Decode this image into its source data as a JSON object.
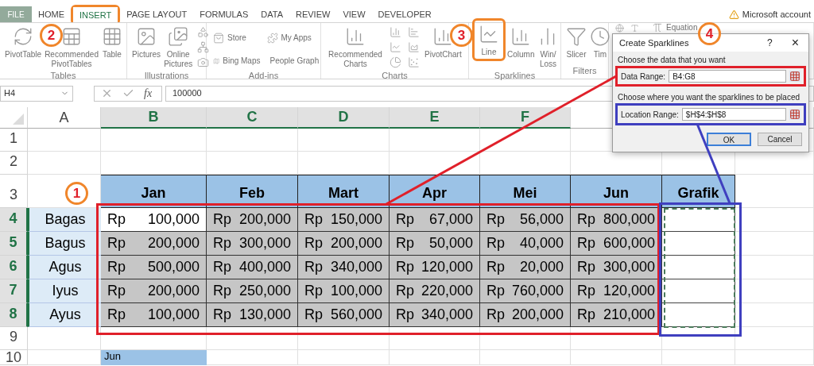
{
  "tabs": [
    {
      "label": "FILE",
      "kind": "file",
      "selected": false
    },
    {
      "label": "HOME",
      "kind": "tab",
      "selected": false
    },
    {
      "label": "INSERT",
      "kind": "tab",
      "selected": true
    },
    {
      "label": "PAGE LAYOUT",
      "kind": "tab",
      "selected": false
    },
    {
      "label": "FORMULAS",
      "kind": "tab",
      "selected": false
    },
    {
      "label": "DATA",
      "kind": "tab",
      "selected": false
    },
    {
      "label": "REVIEW",
      "kind": "tab",
      "selected": false
    },
    {
      "label": "VIEW",
      "kind": "tab",
      "selected": false
    },
    {
      "label": "DEVELOPER",
      "kind": "tab",
      "selected": false
    }
  ],
  "account": {
    "label": "Microsoft account"
  },
  "ribbon": [
    {
      "label": "Tables",
      "items": [
        {
          "kind": "large",
          "label": "PivotTable"
        },
        {
          "kind": "large",
          "label": "Recommended PivotTables"
        },
        {
          "kind": "large",
          "label": "Table"
        }
      ]
    },
    {
      "label": "Illustrations",
      "items": [
        {
          "kind": "large",
          "label": "Pictures"
        },
        {
          "kind": "large",
          "label": "Online Pictures"
        },
        {
          "kind": "icons"
        }
      ]
    },
    {
      "label": "Add-ins",
      "items": [
        {
          "kind": "small",
          "label": "Store"
        },
        {
          "kind": "small",
          "label": "My Apps"
        },
        {
          "kind": "small",
          "label": "Bing Maps"
        },
        {
          "kind": "small",
          "label": "People Graph"
        }
      ]
    },
    {
      "label": "Charts",
      "items": [
        {
          "kind": "large",
          "label": "Recommended Charts"
        },
        {
          "kind": "icons"
        },
        {
          "kind": "large",
          "label": "PivotChart"
        }
      ]
    },
    {
      "label": "Sparklines",
      "items": [
        {
          "kind": "large",
          "label": "Line"
        },
        {
          "kind": "large",
          "label": "Column"
        },
        {
          "kind": "large",
          "label": "Win/ Loss"
        }
      ]
    },
    {
      "label": "Filters",
      "items": [
        {
          "kind": "large",
          "label": "Slicer"
        },
        {
          "kind": "large",
          "label": "Tim"
        }
      ]
    },
    {
      "items": [
        {
          "kind": "icons"
        },
        {
          "kind": "small",
          "label": "Equation"
        }
      ]
    }
  ],
  "formula_bar": {
    "name_box": "H4",
    "function_label": "fx",
    "value": "100000"
  },
  "sheet": {
    "columns": [
      {
        "letter": "A",
        "selected": false
      },
      {
        "letter": "B",
        "selected": true
      },
      {
        "letter": "C",
        "selected": true
      },
      {
        "letter": "D",
        "selected": true
      },
      {
        "letter": "E",
        "selected": true
      },
      {
        "letter": "F",
        "selected": true
      }
    ],
    "rows": [
      {
        "kind": "blank",
        "header": "1",
        "selected": false
      },
      {
        "kind": "blank",
        "header": "2",
        "selected": false
      },
      {
        "kind": "heading",
        "header": "3",
        "selected": false,
        "cells": [
          "Jan",
          "Feb",
          "Mart",
          "Apr",
          "Mei",
          "Jun",
          "Grafik"
        ]
      },
      {
        "kind": "data",
        "header": "4",
        "selected": true,
        "name": "Bagas",
        "cells": [
          {
            "symbol": "Rp",
            "amount": "100,000",
            "selected": false
          },
          {
            "symbol": "Rp",
            "amount": "200,000",
            "selected": true
          },
          {
            "symbol": "Rp",
            "amount": "150,000",
            "selected": true
          },
          {
            "symbol": "Rp",
            "amount": "67,000",
            "selected": true
          },
          {
            "symbol": "Rp",
            "amount": "56,000",
            "selected": true
          },
          {
            "symbol": "Rp",
            "amount": "800,000",
            "selected": true
          }
        ]
      },
      {
        "kind": "data",
        "header": "5",
        "selected": true,
        "name": "Bagus",
        "cells": [
          {
            "symbol": "Rp",
            "amount": "200,000",
            "selected": true
          },
          {
            "symbol": "Rp",
            "amount": "300,000",
            "selected": true
          },
          {
            "symbol": "Rp",
            "amount": "200,000",
            "selected": true
          },
          {
            "symbol": "Rp",
            "amount": "50,000",
            "selected": true
          },
          {
            "symbol": "Rp",
            "amount": "40,000",
            "selected": true
          },
          {
            "symbol": "Rp",
            "amount": "600,000",
            "selected": true
          }
        ]
      },
      {
        "kind": "data",
        "header": "6",
        "selected": true,
        "name": "Agus",
        "cells": [
          {
            "symbol": "Rp",
            "amount": "500,000",
            "selected": true
          },
          {
            "symbol": "Rp",
            "amount": "400,000",
            "selected": true
          },
          {
            "symbol": "Rp",
            "amount": "340,000",
            "selected": true
          },
          {
            "symbol": "Rp",
            "amount": "120,000",
            "selected": true
          },
          {
            "symbol": "Rp",
            "amount": "20,000",
            "selected": true
          },
          {
            "symbol": "Rp",
            "amount": "300,000",
            "selected": true
          }
        ]
      },
      {
        "kind": "data",
        "header": "7",
        "selected": true,
        "name": "Iyus",
        "cells": [
          {
            "symbol": "Rp",
            "amount": "200,000",
            "selected": true
          },
          {
            "symbol": "Rp",
            "amount": "250,000",
            "selected": true
          },
          {
            "symbol": "Rp",
            "amount": "100,000",
            "selected": true
          },
          {
            "symbol": "Rp",
            "amount": "220,000",
            "selected": true
          },
          {
            "symbol": "Rp",
            "amount": "760,000",
            "selected": true
          },
          {
            "symbol": "Rp",
            "amount": "120,000",
            "selected": true
          }
        ]
      },
      {
        "kind": "data",
        "header": "8",
        "selected": true,
        "name": "Ayus",
        "cells": [
          {
            "symbol": "Rp",
            "amount": "100,000",
            "selected": true
          },
          {
            "symbol": "Rp",
            "amount": "130,000",
            "selected": true
          },
          {
            "symbol": "Rp",
            "amount": "560,000",
            "selected": true
          },
          {
            "symbol": "Rp",
            "amount": "340,000",
            "selected": true
          },
          {
            "symbol": "Rp",
            "amount": "200,000",
            "selected": true
          },
          {
            "symbol": "Rp",
            "amount": "210,000",
            "selected": true
          }
        ]
      },
      {
        "kind": "blank",
        "header": "9",
        "selected": false
      },
      {
        "kind": "label",
        "header": "10",
        "selected": false,
        "cells": [
          "Jun"
        ]
      }
    ]
  },
  "dialog": {
    "title": "Create Sparklines",
    "help": "?",
    "close": "×",
    "data_prompt": "Choose the data that you want",
    "data_label": "Data Range:",
    "data_value": "B4:G8",
    "location_prompt": "Choose where you want the sparklines to be placed",
    "location_label": "Location Range:",
    "location_value": "$H$4:$H$8",
    "buttons": [
      {
        "label": "OK",
        "kind": "default"
      },
      {
        "label": "Cancel",
        "kind": "normal"
      }
    ]
  },
  "callouts": [
    "1",
    "2",
    "3",
    "4"
  ]
}
